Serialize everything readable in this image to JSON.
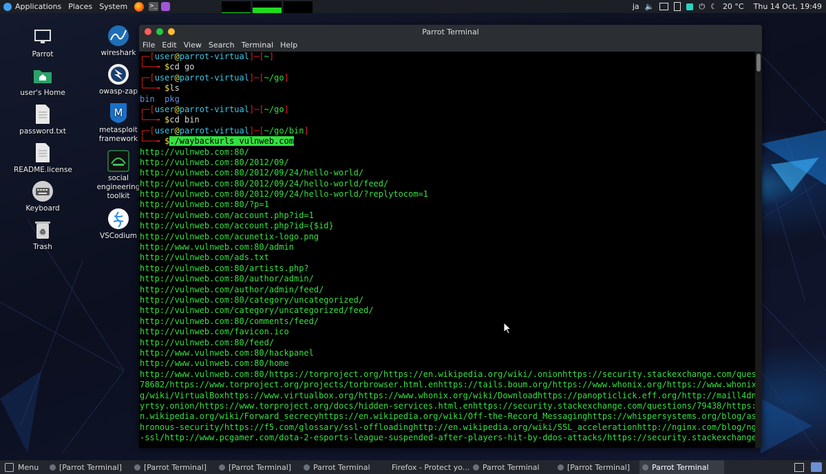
{
  "top_panel": {
    "applications": "Applications",
    "places": "Places",
    "system": "System",
    "graphs": [
      {
        "level": 0.05,
        "color": "#1fdc1f"
      },
      {
        "level": 0.45,
        "color": "#1fdc1f"
      },
      {
        "level": 0.0,
        "color": "#1fdc1f"
      }
    ],
    "keyboard_layout": "ja",
    "weather": "20 °C",
    "clock": "Thu 14 Oct, 19:49"
  },
  "desktop": {
    "icons": [
      {
        "label": "Parrot",
        "icon": "monitor-icon"
      },
      {
        "label": "user's Home",
        "icon": "home-folder-icon"
      },
      {
        "label": "password.txt",
        "icon": "text-file-icon"
      },
      {
        "label": "README.license",
        "icon": "text-file-icon"
      },
      {
        "label": "Keyboard",
        "icon": "keyboard-icon"
      },
      {
        "label": "Trash",
        "icon": "trash-icon"
      },
      {
        "label": "wireshark",
        "icon": "wireshark-icon"
      },
      {
        "label": "owasp-zap",
        "icon": "zap-icon"
      },
      {
        "label": "metasploit framework",
        "icon": "metasploit-icon"
      },
      {
        "label": "social engineering toolkit",
        "icon": "set-icon"
      },
      {
        "label": "VSCodium",
        "icon": "vscodium-icon"
      }
    ]
  },
  "terminal": {
    "title": "Parrot Terminal",
    "menu": [
      "File",
      "Edit",
      "View",
      "Search",
      "Terminal",
      "Help"
    ],
    "prompts": [
      {
        "user": "user",
        "host": "parrot-virtual",
        "dir": "~",
        "cmd": "cd go"
      },
      {
        "user": "user",
        "host": "parrot-virtual",
        "dir": "~/go",
        "cmd": "ls"
      },
      {
        "user": "user",
        "host": "parrot-virtual",
        "dir": "~/go",
        "cmd": "cd bin"
      },
      {
        "user": "user",
        "host": "parrot-virtual",
        "dir": "~/go/bin",
        "cmd": "./waybackurls vulnweb.com"
      }
    ],
    "ls_output": [
      "bin",
      "pkg"
    ],
    "output_lines": [
      "http://vulnweb.com:80/",
      "http://vulnweb.com:80/2012/09/",
      "http://vulnweb.com:80/2012/09/24/hello-world/",
      "http://vulnweb.com:80/2012/09/24/hello-world/feed/",
      "http://vulnweb.com:80/2012/09/24/hello-world/?replytocom=1",
      "http://vulnweb.com:80/?p=1",
      "http://vulnweb.com/account.php?id=1",
      "http://vulnweb.com/account.php?id={$id}",
      "http://vulnweb.com/acunetix-logo.png",
      "http://www.vulnweb.com:80/admin",
      "http://vulnweb.com/ads.txt",
      "http://vulnweb.com:80/artists.php?",
      "http://vulnweb.com:80/author/admin/",
      "http://vulnweb.com/author/admin/feed/",
      "http://vulnweb.com:80/category/uncategorized/",
      "http://vulnweb.com/category/uncategorized/feed/",
      "http://vulnweb.com:80/comments/feed/",
      "http://vulnweb.com/favicon.ico",
      "http://vulnweb.com:80/feed/",
      "http://www.vulnweb.com:80/hackpanel",
      "http://www.vulnweb.com:80/home",
      "http://www.vulnweb.com:80/https://torproject.org/https://en.wikipedia.org/wiki/.onionhttps://security.stackexchange.com/questions/",
      "78682/https://www.torproject.org/projects/torbrowser.html.enhttps://tails.boum.org/https://www.whonix.org/https://www.whonix.or",
      "g/wiki/VirtualBoxhttps://www.virtualbox.org/https://www.whonix.org/wiki/Downloadhttps://panopticlick.eff.org/http://maill4dnx45",
      "yrtsy.onion/https://www.torproject.org/docs/hidden-services.html.enhttps://security.stackexchange.com/questions/79438/https://e",
      "n.wikipedia.org/wiki/Forward_secrecyhttps://en.wikipedia.org/wiki/Off-the-Record_Messaginghttps://whispersystems.org/blog/async",
      "hronous-security/https://f5.com/glossary/ssl-offloadinghttp://en.wikipedia.org/wiki/SSL_accelerationhttp://nginx.com/blog/nginx",
      "-ssl/http://www.pcgamer.com/dota-2-esports-league-suspended-after-players-hit-by-ddos-attacks/https://security.stackexchange.co"
    ]
  },
  "taskbar": {
    "menu": "Menu",
    "items": [
      {
        "label": "[Parrot Terminal]",
        "active": false
      },
      {
        "label": "[Parrot Terminal]",
        "active": false
      },
      {
        "label": "[Parrot Terminal]",
        "active": false
      },
      {
        "label": "Parrot Terminal",
        "active": false
      },
      {
        "label": "Firefox - Protect yo...",
        "active": false
      },
      {
        "label": "Parrot Terminal",
        "active": false
      },
      {
        "label": "[Parrot Terminal]",
        "active": false
      },
      {
        "label": "Parrot Terminal",
        "active": true
      }
    ]
  }
}
